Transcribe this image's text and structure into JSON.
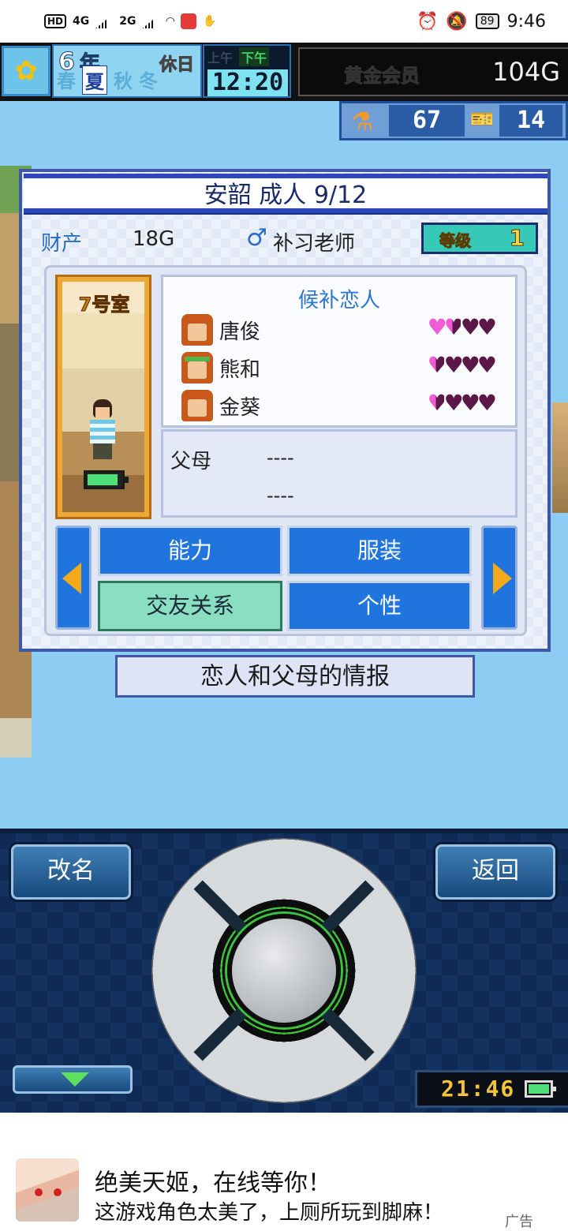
{
  "status_bar": {
    "hd": "HD",
    "net1": "4G",
    "net2": "2G",
    "battery": "89",
    "time": "9:46"
  },
  "top_bar": {
    "year_number": "6",
    "year_label": "年",
    "holiday": "休日",
    "seasons": [
      "春",
      "夏",
      "秋",
      "冬"
    ],
    "active_season": "夏",
    "am": "上午",
    "pm": "下午",
    "clock": "12:20",
    "membership": "黄金会员",
    "gold": "104G"
  },
  "resources": {
    "research_points": "67",
    "tickets": "14"
  },
  "dialog": {
    "title": "安韶 成人 9/12",
    "asset_label": "财产",
    "asset_value": "18G",
    "gender_icon": "♂",
    "job": "补习老师",
    "level_label": "等级",
    "level_value": "1",
    "room": "7号室",
    "lovers_heading": "候补恋人",
    "lovers": [
      {
        "name": "唐俊",
        "hearts": [
          1,
          0.5,
          0,
          0
        ]
      },
      {
        "name": "熊和",
        "hearts": [
          0.5,
          0,
          0,
          0
        ]
      },
      {
        "name": "金葵",
        "hearts": [
          0.5,
          0,
          0,
          0
        ]
      }
    ],
    "parents_label": "父母",
    "parent1": "----",
    "parent2": "----",
    "tabs": {
      "ability": "能力",
      "outfit": "服装",
      "friends": "交友关系",
      "personality": "个性"
    },
    "active_tab": "交友关系"
  },
  "caption": "恋人和父母的情报",
  "controls": {
    "rename": "改名",
    "back": "返回",
    "clock": "21:46"
  },
  "ad": {
    "title": "绝美天姬，在线等你！",
    "text": "这游戏角色太美了，上厕所玩到脚麻！",
    "tag": "广告"
  },
  "colors": {
    "dialog_border": "#3f57a7",
    "tab_blue": "#1f74de",
    "tab_active": "#8adfc2",
    "heart_pink": "#f15bd6",
    "heart_dark": "#5a1748",
    "world_bg": "#8ecdf3"
  }
}
